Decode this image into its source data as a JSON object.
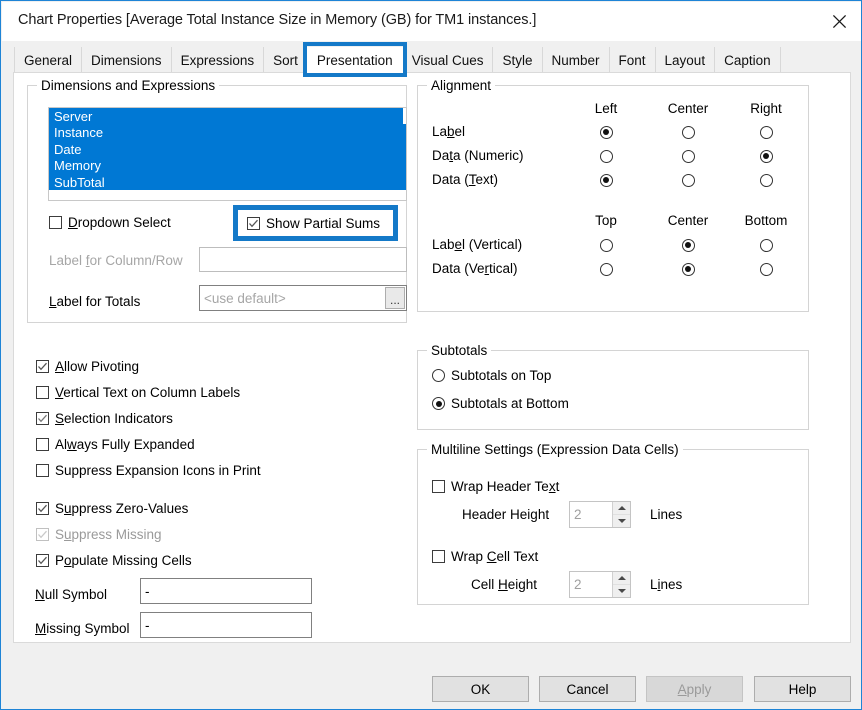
{
  "window": {
    "title": "Chart Properties [Average Total Instance Size in Memory (GB) for TM1 instances.]",
    "close_icon": "close-icon",
    "accent_color": "#1479c8",
    "selection_color": "#0078d4"
  },
  "tabs": [
    {
      "label": "General",
      "active": false
    },
    {
      "label": "Dimensions",
      "active": false
    },
    {
      "label": "Expressions",
      "active": false
    },
    {
      "label": "Sort",
      "active": false
    },
    {
      "label": "Presentation",
      "active": true
    },
    {
      "label": "Visual Cues",
      "active": false
    },
    {
      "label": "Style",
      "active": false
    },
    {
      "label": "Number",
      "active": false
    },
    {
      "label": "Font",
      "active": false
    },
    {
      "label": "Layout",
      "active": false
    },
    {
      "label": "Caption",
      "active": false
    }
  ],
  "dimensions_group": {
    "legend": "Dimensions and Expressions",
    "list_items": [
      {
        "label": "Server",
        "selected": true
      },
      {
        "label": "Instance",
        "selected": true
      },
      {
        "label": "Date",
        "selected": true
      },
      {
        "label": "Memory",
        "selected": true
      },
      {
        "label": "SubTotal",
        "selected": true
      }
    ],
    "dropdown_select": {
      "label": "Dropdown Select",
      "checked": false,
      "accel": "D"
    },
    "show_partial_sums": {
      "label": "Show Partial Sums",
      "checked": true,
      "highlighted": true
    },
    "label_for_column_row": {
      "label": "Label for Column/Row",
      "value": "",
      "disabled": true,
      "accel": "f"
    },
    "label_for_totals": {
      "label": "Label for Totals",
      "placeholder": "<use default>",
      "value": "",
      "accel": "L",
      "browse_label": "..."
    }
  },
  "alignment_group": {
    "legend": "Alignment",
    "horizontal_headers": [
      "Left",
      "Center",
      "Right"
    ],
    "horizontal_rows": [
      {
        "label": "Label",
        "selected": 0
      },
      {
        "label": "Data (Numeric)",
        "selected": 2
      },
      {
        "label": "Data (Text)",
        "selected": 0
      }
    ],
    "vertical_headers": [
      "Top",
      "Center",
      "Bottom"
    ],
    "vertical_rows": [
      {
        "label": "Label (Vertical)",
        "selected": 1
      },
      {
        "label": "Data (Vertical)",
        "selected": 1
      }
    ]
  },
  "options": [
    {
      "label": "Allow Pivoting",
      "checked": true,
      "disabled": false
    },
    {
      "label": "Vertical Text on Column Labels",
      "checked": false,
      "disabled": false
    },
    {
      "label": "Selection Indicators",
      "checked": true,
      "disabled": false
    },
    {
      "label": "Always Fully Expanded",
      "checked": false,
      "disabled": false
    },
    {
      "label": "Suppress Expansion Icons in Print",
      "checked": false,
      "disabled": false
    },
    {
      "label": "Suppress Zero-Values",
      "checked": true,
      "disabled": false
    },
    {
      "label": "Suppress Missing",
      "checked": true,
      "disabled": true
    },
    {
      "label": "Populate Missing Cells",
      "checked": true,
      "disabled": false
    }
  ],
  "symbols": {
    "null_symbol": {
      "label": "Null Symbol",
      "value": "-"
    },
    "missing_symbol": {
      "label": "Missing Symbol",
      "value": "-"
    }
  },
  "subtotals_group": {
    "legend": "Subtotals",
    "options": [
      {
        "label": "Subtotals on Top",
        "selected": false
      },
      {
        "label": "Subtotals at Bottom",
        "selected": true
      }
    ]
  },
  "multiline_group": {
    "legend": "Multiline Settings (Expression Data Cells)",
    "wrap_header_text": {
      "label": "Wrap Header Text",
      "checked": false
    },
    "header_height": {
      "label": "Header Height",
      "value": "2",
      "units": "Lines"
    },
    "wrap_cell_text": {
      "label": "Wrap Cell Text",
      "checked": false
    },
    "cell_height": {
      "label": "Cell Height",
      "value": "2",
      "units": "Lines"
    }
  },
  "footer_buttons": [
    {
      "label": "OK",
      "disabled": false
    },
    {
      "label": "Cancel",
      "disabled": false
    },
    {
      "label": "Apply",
      "disabled": true
    },
    {
      "label": "Help",
      "disabled": false
    }
  ]
}
